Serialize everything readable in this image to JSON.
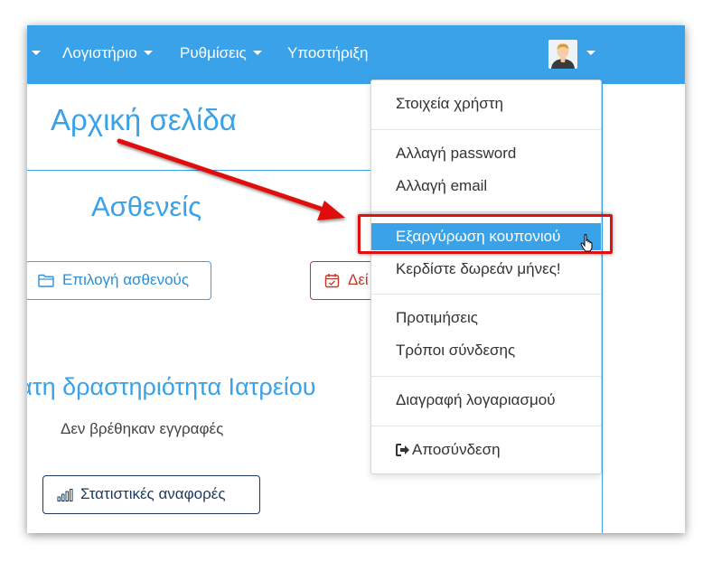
{
  "navbar": {
    "bg_color": "#3aa2e8",
    "items": [
      {
        "label": ""
      },
      {
        "label": "Λογιστήριο"
      },
      {
        "label": "Ρυθμίσεις"
      },
      {
        "label": "Υποστήριξη"
      }
    ],
    "user_icon": "user-avatar-icon"
  },
  "page": {
    "title": "Αρχική σελίδα",
    "patients_title": "Ασθενείς",
    "select_patient_label": "Επιλογή ασθενούς",
    "select_patient_icon": "folder-icon",
    "red_button_label": "Δεί",
    "red_button_icon": "calendar-icon",
    "recent_title": "ρατη δραστηριότητα Ιατρείου",
    "no_records": "Δεν βρέθηκαν εγγραφές",
    "stats_label": "Στατιστικές αναφορές",
    "stats_icon": "bar-chart-icon"
  },
  "dropdown": {
    "user_details": "Στοιχεία χρήστη",
    "change_password": "Αλλαγή password",
    "change_email": "Αλλαγή email",
    "redeem_coupon": "Εξαργύρωση κουπονιού",
    "free_months": "Κερδίστε δωρεάν μήνες!",
    "preferences": "Προτιμήσεις",
    "login_methods": "Τρόποι σύνδεσης",
    "delete_account": "Διαγραφή λογαριασμού",
    "logout": "Αποσύνδεση",
    "logout_icon": "sign-out-icon"
  },
  "annotation": {
    "highlight_color": "#e01010",
    "arrow_color": "#e01010",
    "cursor_icon": "hand-pointer-icon"
  }
}
